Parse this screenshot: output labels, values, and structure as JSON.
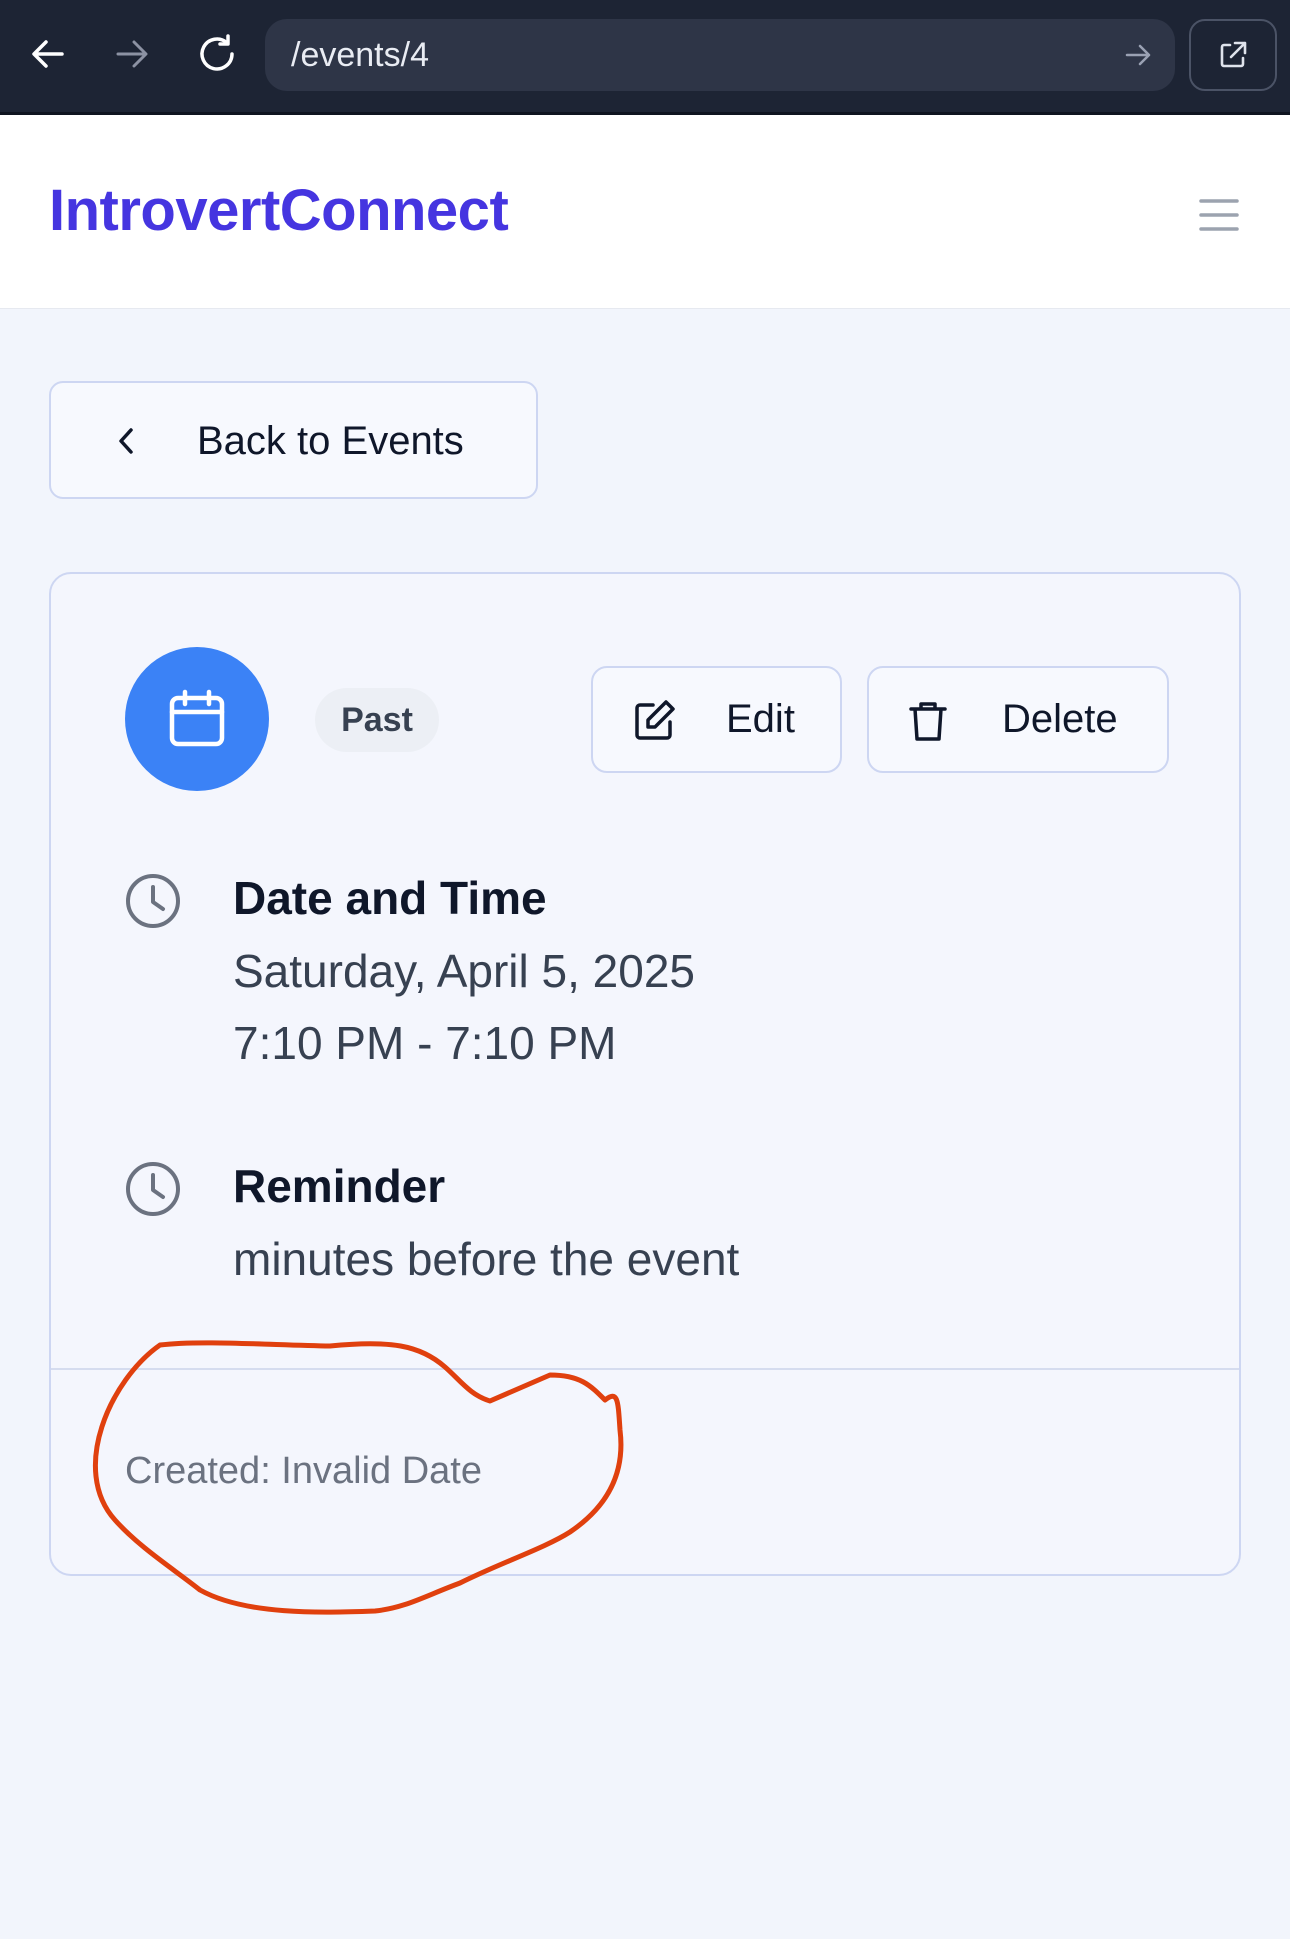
{
  "browser": {
    "url": "/events/4",
    "icons": [
      "back-arrow-icon",
      "forward-arrow-icon",
      "reload-icon",
      "go-arrow-icon",
      "external-link-icon"
    ]
  },
  "header": {
    "brand": "IntrovertConnect",
    "brand_color": "#4535e0",
    "menu_icon": "hamburger-menu-icon"
  },
  "back_button": {
    "label": "Back to Events",
    "icon": "chevron-left-icon"
  },
  "event": {
    "icon": "calendar-icon",
    "icon_bg": "#3b82f6",
    "status": "Past",
    "actions": {
      "edit_label": "Edit",
      "delete_label": "Delete"
    },
    "date_time": {
      "title": "Date and Time",
      "date": "Saturday, April 5, 2025",
      "time": "7:10 PM - 7:10 PM"
    },
    "reminder": {
      "title": "Reminder",
      "text": "minutes before the event"
    },
    "created": "Created: Invalid Date"
  },
  "annotation": {
    "color": "#e0400e"
  }
}
